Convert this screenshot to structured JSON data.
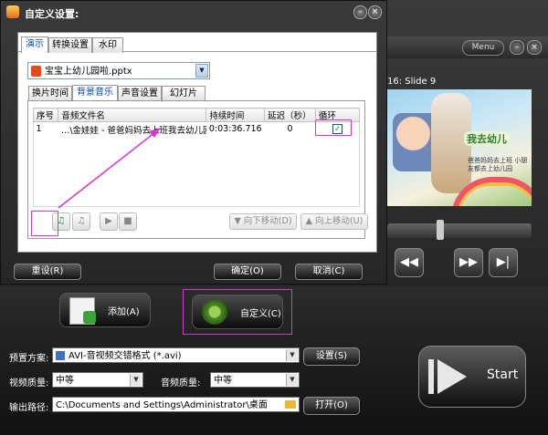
{
  "dialog": {
    "title": "自定义设置:",
    "min_glyph": "–",
    "close_glyph": "×",
    "tabs": [
      "演示",
      "转换设置",
      "水印"
    ],
    "file": "宝宝上幼儿园啦.pptx",
    "sub_tabs": [
      "换片时间",
      "背景音乐",
      "声音设置",
      "幻灯片"
    ],
    "table": {
      "headers": [
        "序号",
        "音频文件名",
        "持续时间",
        "延迟（秒）",
        "循环"
      ],
      "rows": [
        {
          "index": "1",
          "file": "…\\金娃娃 - 爸爸妈妈去上班我去幼儿园",
          "duration": "0:03:36.716",
          "delay": "0",
          "loop": "✓"
        }
      ]
    },
    "move_down": "向下移动(D)",
    "move_up": "向上移动(U)",
    "reset": "重设(R)",
    "ok": "确定(O)",
    "cancel": "取消(C)"
  },
  "app": {
    "menu": "Menu",
    "slide_label": "16: Slide 9",
    "preview_title": "我去幼儿",
    "preview_text": "爸爸妈妈去上班 小朋友都去上幼儿园",
    "add": "添加(A)",
    "custom": "自定义(C)",
    "preset_label": "预置方案:",
    "preset_value": "AVI-音视频交错格式 (*.avi)",
    "settings_btn": "设置(S)",
    "video_quality_label": "视频质量:",
    "video_quality": "中等",
    "audio_quality_label": "音频质量:",
    "audio_quality": "中等",
    "output_label": "输出路径:",
    "output_path": "C:\\Documents and Settings\\Administrator\\桌面",
    "open_btn": "打开(O)",
    "start": "Start"
  },
  "colors": {
    "highlight": "#d238d2",
    "tab_active": "#0047b3"
  }
}
